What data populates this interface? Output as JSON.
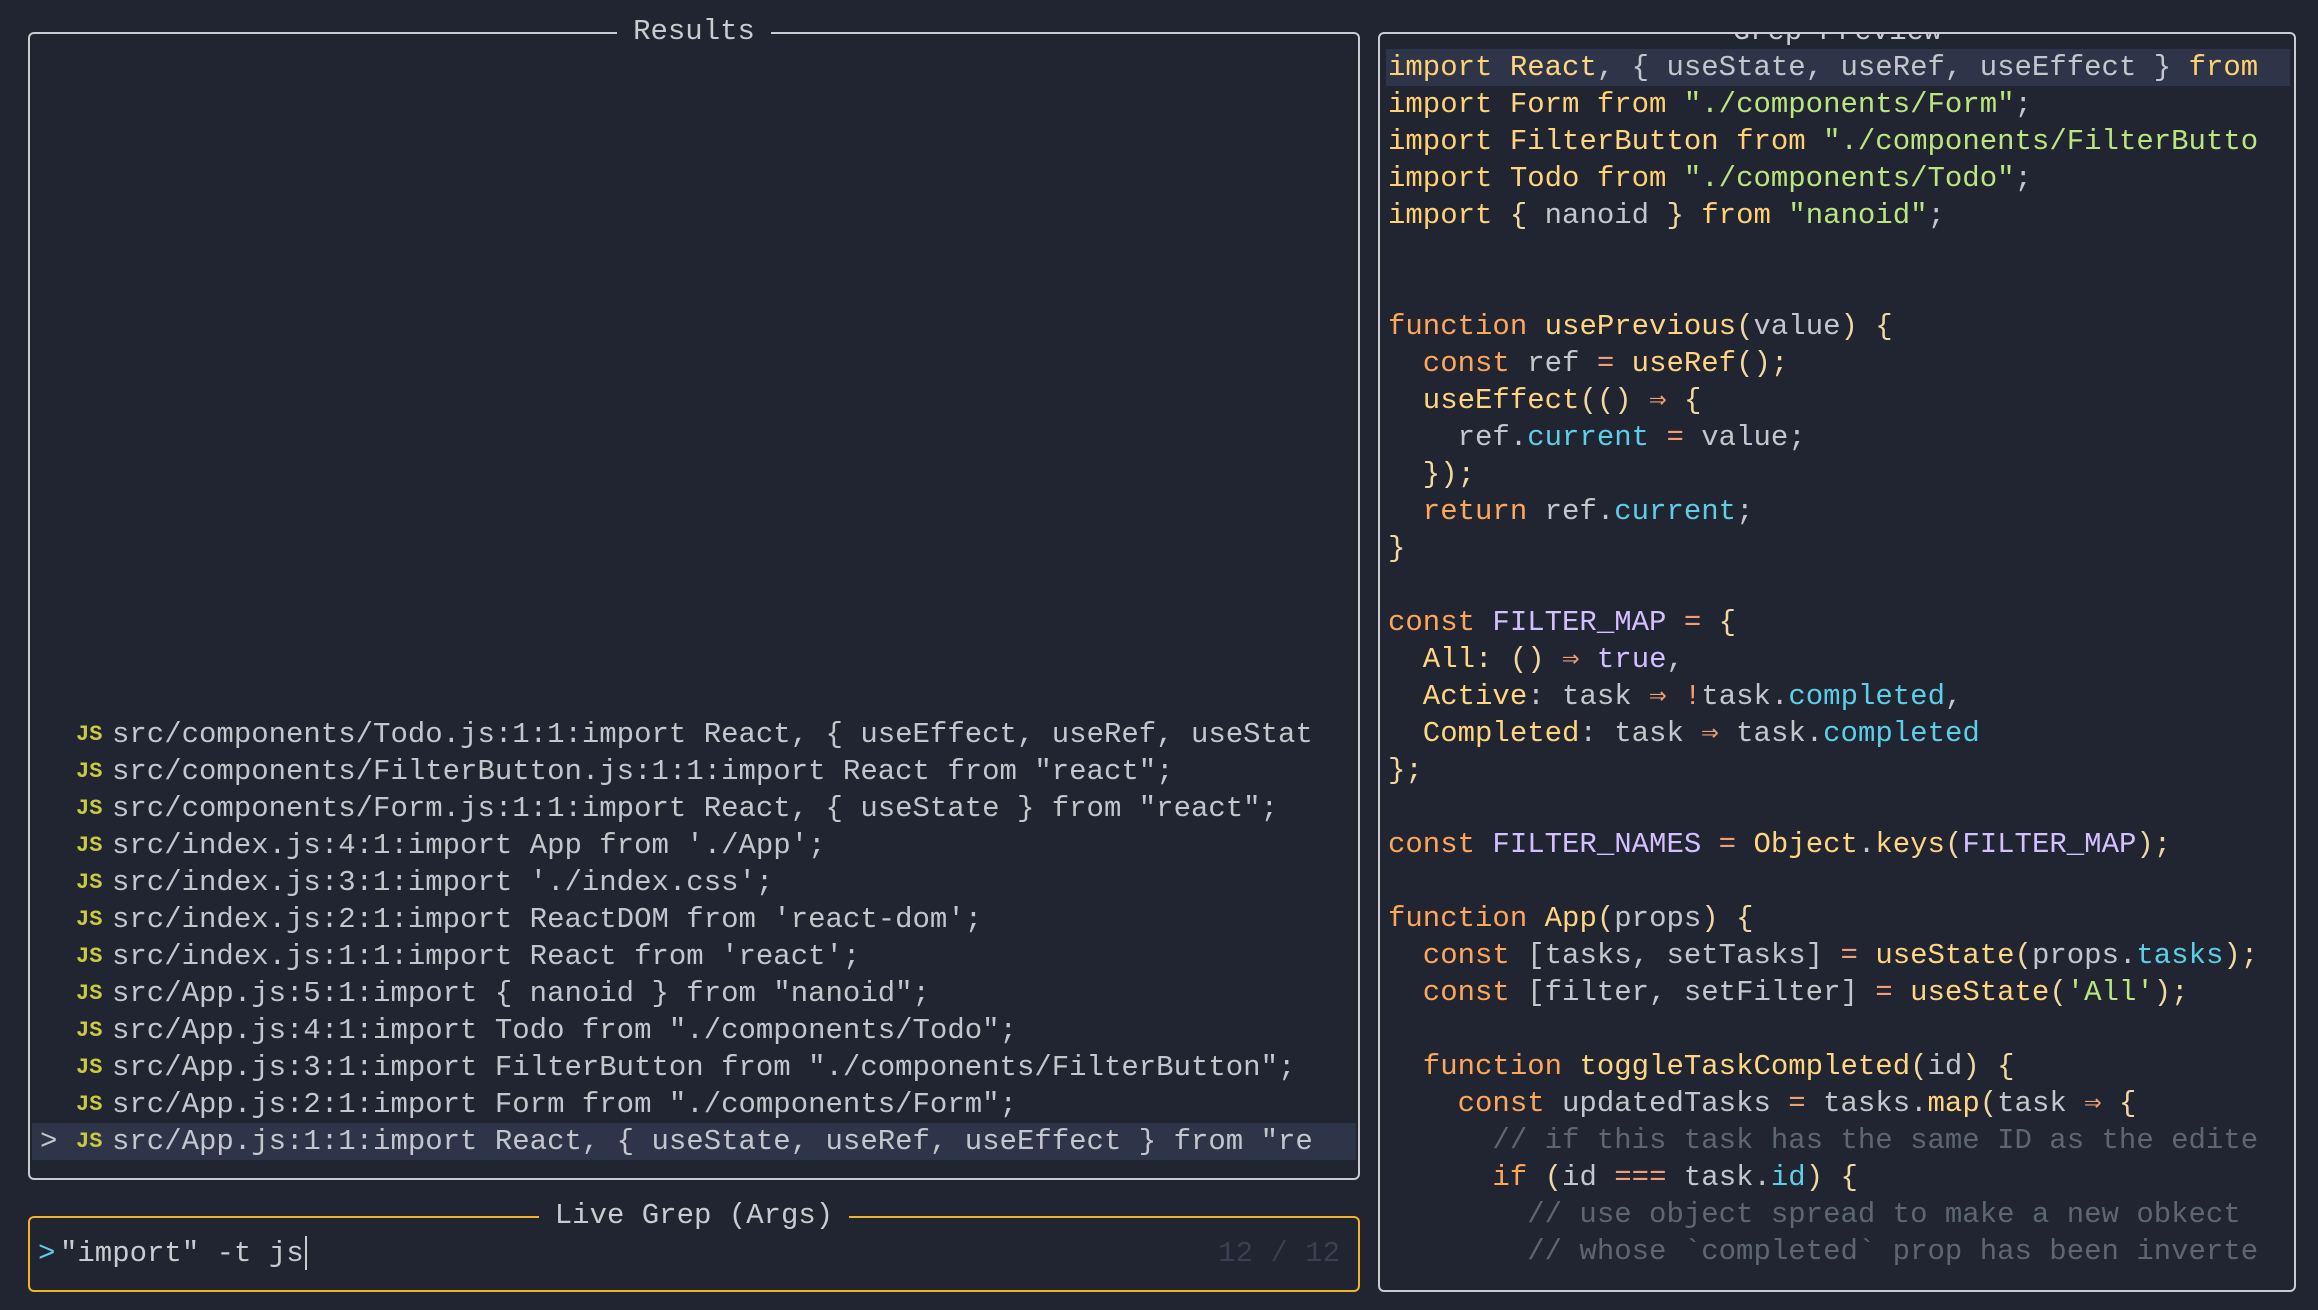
{
  "results": {
    "title": "Results",
    "selected_marker": ">",
    "file_icon": "JS",
    "items": [
      "src/components/Todo.js:1:1:import React, { useEffect, useRef, useStat",
      "src/components/FilterButton.js:1:1:import React from \"react\";",
      "src/components/Form.js:1:1:import React, { useState } from \"react\";",
      "src/index.js:4:1:import App from './App';",
      "src/index.js:3:1:import './index.css';",
      "src/index.js:2:1:import ReactDOM from 'react-dom';",
      "src/index.js:1:1:import React from 'react';",
      "src/App.js:5:1:import { nanoid } from \"nanoid\";",
      "src/App.js:4:1:import Todo from \"./components/Todo\";",
      "src/App.js:3:1:import FilterButton from \"./components/FilterButton\";",
      "src/App.js:2:1:import Form from \"./components/Form\";",
      "src/App.js:1:1:import React, { useState, useRef, useEffect } from \"re"
    ],
    "selected_index": 11
  },
  "prompt": {
    "title": "Live Grep (Args)",
    "chevron": ">",
    "value": "\"import\" -t js",
    "counter": "12 / 12"
  },
  "preview": {
    "title": "Grep Preview",
    "highlight_line": 0,
    "lines": [
      [
        [
          "import ",
          "kw"
        ],
        [
          "React",
          "fn"
        ],
        [
          ", { ",
          "tx"
        ],
        [
          "useState, useRef, useEffect",
          "tx"
        ],
        [
          " } ",
          "tx"
        ],
        [
          "from",
          "kw"
        ]
      ],
      [
        [
          "import ",
          "kw"
        ],
        [
          "Form ",
          "fn"
        ],
        [
          "from ",
          "kw"
        ],
        [
          "\"./components/Form\"",
          "st"
        ],
        [
          ";",
          "tx"
        ]
      ],
      [
        [
          "import ",
          "kw"
        ],
        [
          "FilterButton ",
          "fn"
        ],
        [
          "from ",
          "kw"
        ],
        [
          "\"./components/FilterButto",
          "st"
        ]
      ],
      [
        [
          "import ",
          "kw"
        ],
        [
          "Todo ",
          "fn"
        ],
        [
          "from ",
          "kw"
        ],
        [
          "\"./components/Todo\"",
          "st"
        ],
        [
          ";",
          "tx"
        ]
      ],
      [
        [
          "import ",
          "kw"
        ],
        [
          "{ ",
          "pn"
        ],
        [
          "nanoid ",
          "tx"
        ],
        [
          "} ",
          "pn"
        ],
        [
          "from ",
          "kw"
        ],
        [
          "\"nanoid\"",
          "st"
        ],
        [
          ";",
          "tx"
        ]
      ],
      [],
      [],
      [
        [
          "function ",
          "kd"
        ],
        [
          "usePrevious",
          "fn"
        ],
        [
          "(",
          "pn"
        ],
        [
          "value",
          "tx"
        ],
        [
          ") {",
          "pn"
        ]
      ],
      [
        [
          "  const ",
          "kd"
        ],
        [
          "ref ",
          "tx"
        ],
        [
          "= ",
          "op"
        ],
        [
          "useRef",
          "fn"
        ],
        [
          "();",
          "pn"
        ]
      ],
      [
        [
          "  useEffect",
          "fn"
        ],
        [
          "(() ",
          "pn"
        ],
        [
          "⇒ ",
          "op"
        ],
        [
          "{",
          "pn"
        ]
      ],
      [
        [
          "    ref.",
          "tx"
        ],
        [
          "current ",
          "pr"
        ],
        [
          "= ",
          "op"
        ],
        [
          "value;",
          "tx"
        ]
      ],
      [
        [
          "  });",
          "pn"
        ]
      ],
      [
        [
          "  return ",
          "kd"
        ],
        [
          "ref.",
          "tx"
        ],
        [
          "current",
          "pr"
        ],
        [
          ";",
          "tx"
        ]
      ],
      [
        [
          "}",
          "pn"
        ]
      ],
      [],
      [
        [
          "const ",
          "kd"
        ],
        [
          "FILTER_MAP ",
          "cn"
        ],
        [
          "= ",
          "op"
        ],
        [
          "{",
          "pn"
        ]
      ],
      [
        [
          "  All",
          "fn"
        ],
        [
          ": () ",
          "pn"
        ],
        [
          "⇒ ",
          "op"
        ],
        [
          "true",
          "cn"
        ],
        [
          ",",
          "tx"
        ]
      ],
      [
        [
          "  Active",
          "fn"
        ],
        [
          ": ",
          "tx"
        ],
        [
          "task ",
          "tx"
        ],
        [
          "⇒ ",
          "op"
        ],
        [
          "!",
          "op"
        ],
        [
          "task.",
          "tx"
        ],
        [
          "completed",
          "pr"
        ],
        [
          ",",
          "tx"
        ]
      ],
      [
        [
          "  Completed",
          "fn"
        ],
        [
          ": ",
          "tx"
        ],
        [
          "task ",
          "tx"
        ],
        [
          "⇒ ",
          "op"
        ],
        [
          "task.",
          "tx"
        ],
        [
          "completed",
          "pr"
        ]
      ],
      [
        [
          "};",
          "pn"
        ]
      ],
      [],
      [
        [
          "const ",
          "kd"
        ],
        [
          "FILTER_NAMES ",
          "cn"
        ],
        [
          "= ",
          "op"
        ],
        [
          "Object",
          "fn"
        ],
        [
          ".",
          "tx"
        ],
        [
          "keys",
          "fn"
        ],
        [
          "(",
          "pn"
        ],
        [
          "FILTER_MAP",
          "cn"
        ],
        [
          ");",
          "pn"
        ]
      ],
      [],
      [
        [
          "function ",
          "kd"
        ],
        [
          "App",
          "fn"
        ],
        [
          "(",
          "pn"
        ],
        [
          "props",
          "tx"
        ],
        [
          ") {",
          "pn"
        ]
      ],
      [
        [
          "  const ",
          "kd"
        ],
        [
          "[tasks, setTasks] ",
          "tx"
        ],
        [
          "= ",
          "op"
        ],
        [
          "useState",
          "fn"
        ],
        [
          "(",
          "pn"
        ],
        [
          "props.",
          "tx"
        ],
        [
          "tasks",
          "pr"
        ],
        [
          ");",
          "pn"
        ]
      ],
      [
        [
          "  const ",
          "kd"
        ],
        [
          "[filter, setFilter] ",
          "tx"
        ],
        [
          "= ",
          "op"
        ],
        [
          "useState",
          "fn"
        ],
        [
          "(",
          "pn"
        ],
        [
          "'All'",
          "st"
        ],
        [
          ");",
          "pn"
        ]
      ],
      [],
      [
        [
          "  function ",
          "kd"
        ],
        [
          "toggleTaskCompleted",
          "fn"
        ],
        [
          "(",
          "pn"
        ],
        [
          "id",
          "tx"
        ],
        [
          ") {",
          "pn"
        ]
      ],
      [
        [
          "    const ",
          "kd"
        ],
        [
          "updatedTasks ",
          "tx"
        ],
        [
          "= ",
          "op"
        ],
        [
          "tasks.",
          "tx"
        ],
        [
          "map",
          "fn"
        ],
        [
          "(",
          "pn"
        ],
        [
          "task ",
          "tx"
        ],
        [
          "⇒ ",
          "op"
        ],
        [
          "{",
          "pn"
        ]
      ],
      [
        [
          "      // if this task has the same ID as the edite",
          "cm"
        ]
      ],
      [
        [
          "      if ",
          "kd"
        ],
        [
          "(",
          "pn"
        ],
        [
          "id ",
          "tx"
        ],
        [
          "=== ",
          "op"
        ],
        [
          "task.",
          "tx"
        ],
        [
          "id",
          "pr"
        ],
        [
          ") {",
          "pn"
        ]
      ],
      [
        [
          "        // use object spread to make a new obkect",
          "cm"
        ]
      ],
      [
        [
          "        // whose `completed` prop has been inverte",
          "cm"
        ]
      ]
    ]
  },
  "colors": {
    "background": "#212431",
    "selection": "#2f3548",
    "prompt_border": "#f0b429",
    "panel_border": "#c9cbd0",
    "js_icon": "#cbcb41"
  }
}
